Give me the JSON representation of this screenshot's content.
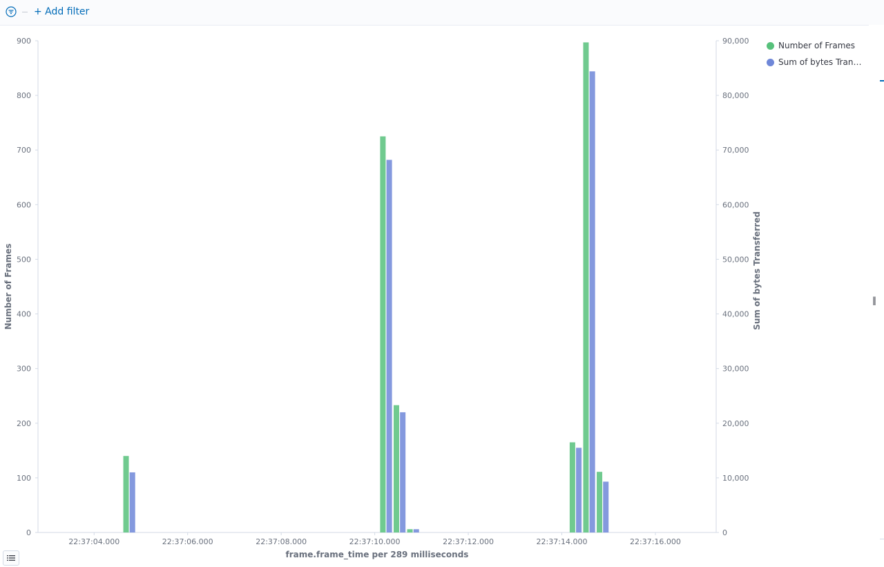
{
  "filter_bar": {
    "add_filter_label": "+ Add filter",
    "filter_icon": "filter-icon"
  },
  "legend": {
    "items": [
      {
        "label": "Number of Frames",
        "color": "#57c17b"
      },
      {
        "label": "Sum of bytes Transf...",
        "color": "#6f87d8"
      }
    ]
  },
  "chart_data": {
    "type": "bar",
    "xlabel": "frame.frame_time per 289 milliseconds",
    "ylabel_left": "Number of Frames",
    "ylabel_right": "Sum of bytes Transferred",
    "ylim_left": [
      0,
      900
    ],
    "ylim_right": [
      0,
      90000
    ],
    "yticks_left": [
      0,
      100,
      200,
      300,
      400,
      500,
      600,
      700,
      800,
      900
    ],
    "yticks_left_labels": [
      "0",
      "100",
      "200",
      "300",
      "400",
      "500",
      "600",
      "700",
      "800",
      "900"
    ],
    "yticks_right": [
      0,
      10000,
      20000,
      30000,
      40000,
      50000,
      60000,
      70000,
      80000,
      90000
    ],
    "yticks_right_labels": [
      "0",
      "10,000",
      "20,000",
      "30,000",
      "40,000",
      "50,000",
      "60,000",
      "70,000",
      "80,000",
      "90,000"
    ],
    "xticks_labels": [
      "22:37:04.000",
      "22:37:06.000",
      "22:37:08.000",
      "22:37:10.000",
      "22:37:12.000",
      "22:37:14.000",
      "22:37:16.000"
    ],
    "xticks_seconds": [
      4,
      6,
      8,
      10,
      12,
      14,
      16
    ],
    "x_range_seconds": [
      2.8,
      17.3
    ],
    "interval_seconds": 0.289,
    "bucket_start_seconds": [
      4.624,
      10.115,
      10.404,
      10.693,
      14.168,
      14.457,
      14.746
    ],
    "series": [
      {
        "name": "Number of Frames",
        "axis": "left",
        "color": "#57c17b",
        "values": [
          140,
          725,
          233,
          6,
          165,
          897,
          111
        ]
      },
      {
        "name": "Sum of bytes Transferred",
        "axis": "right",
        "color": "#6f87d8",
        "values": [
          11000,
          68200,
          22000,
          600,
          15500,
          84400,
          9300
        ]
      }
    ],
    "grid": false,
    "legend_position": "top-right"
  }
}
